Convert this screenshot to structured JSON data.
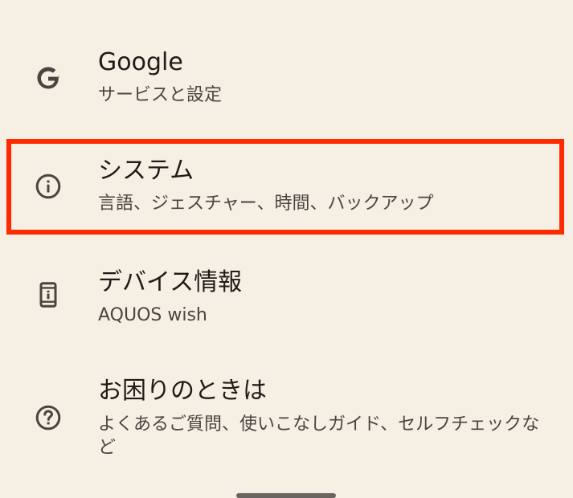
{
  "settings": {
    "items": [
      {
        "icon": "google-g-icon",
        "title": "Google",
        "subtitle": "サービスと設定"
      },
      {
        "icon": "info-icon",
        "title": "システム",
        "subtitle": "言語、ジェスチャー、時間、バックアップ",
        "highlighted": true
      },
      {
        "icon": "phone-info-icon",
        "title": "デバイス情報",
        "subtitle": "AQUOS wish"
      },
      {
        "icon": "help-icon",
        "title": "お困りのときは",
        "subtitle": "よくあるご質問、使いこなしガイド、セルフチェックなど"
      }
    ]
  },
  "colors": {
    "background": "#f5efe4",
    "highlight_border": "#ff2a00",
    "icon": "#4a4540"
  }
}
